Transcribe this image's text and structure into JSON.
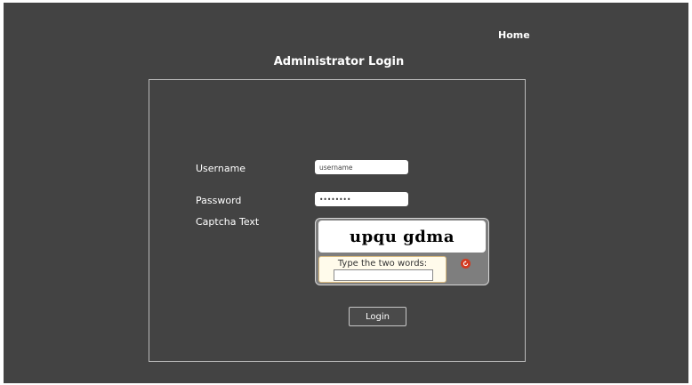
{
  "nav": {
    "home_label": "Home"
  },
  "header": {
    "title": "Administrator Login"
  },
  "form": {
    "username_label": "Username",
    "username_placeholder": "username",
    "password_label": "Password",
    "password_value": "••••••••",
    "captcha_label": "Captcha Text",
    "captcha_words": "upqu gdma",
    "captcha_prompt": "Type the two words:",
    "captcha_answer_value": "",
    "refresh_icon": "refresh-icon",
    "login_label": "Login"
  },
  "colors": {
    "page_bg": "#434343",
    "panel_border": "#b9b9b9",
    "refresh_red": "#d23b21"
  }
}
